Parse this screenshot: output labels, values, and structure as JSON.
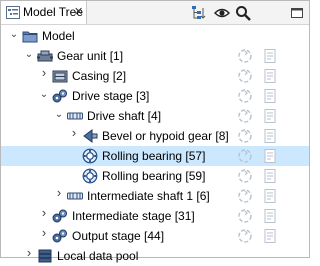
{
  "tab": {
    "title": "Model Tree",
    "close_glyph": "✕"
  },
  "toolbar": {
    "icons": [
      "expand-tree-icon",
      "eye-icon",
      "search-icon",
      "minimize-icon"
    ]
  },
  "tree": [
    {
      "label": "Model",
      "depth": 0,
      "toggle": "expanded",
      "icon": "folder-icon",
      "status": false
    },
    {
      "label": "Gear unit [1]",
      "depth": 1,
      "toggle": "expanded",
      "icon": "gear-unit-icon",
      "status": true
    },
    {
      "label": "Casing [2]",
      "depth": 2,
      "toggle": "collapsed",
      "icon": "casing-icon",
      "status": true
    },
    {
      "label": "Drive stage [3]",
      "depth": 2,
      "toggle": "expanded",
      "icon": "drive-stage-icon",
      "status": true
    },
    {
      "label": "Drive shaft [4]",
      "depth": 3,
      "toggle": "expanded",
      "icon": "shaft-icon",
      "status": true
    },
    {
      "label": "Bevel or hypoid gear [8]",
      "depth": 4,
      "toggle": "collapsed",
      "icon": "bevel-gear-icon",
      "status": true
    },
    {
      "label": "Rolling bearing [57]",
      "depth": 4,
      "toggle": "none",
      "icon": "bearing-icon",
      "status": true,
      "selected": true
    },
    {
      "label": "Rolling bearing [59]",
      "depth": 4,
      "toggle": "none",
      "icon": "bearing-icon",
      "status": true
    },
    {
      "label": "Intermediate shaft 1 [6]",
      "depth": 3,
      "toggle": "collapsed",
      "icon": "shaft-icon",
      "status": true
    },
    {
      "label": "Intermediate stage [31]",
      "depth": 2,
      "toggle": "collapsed",
      "icon": "drive-stage-icon",
      "status": true
    },
    {
      "label": "Output stage [44]",
      "depth": 2,
      "toggle": "collapsed",
      "icon": "drive-stage-icon",
      "status": true
    },
    {
      "label": "Local data pool",
      "depth": 1,
      "toggle": "collapsed",
      "icon": "data-pool-icon",
      "status": false
    }
  ]
}
